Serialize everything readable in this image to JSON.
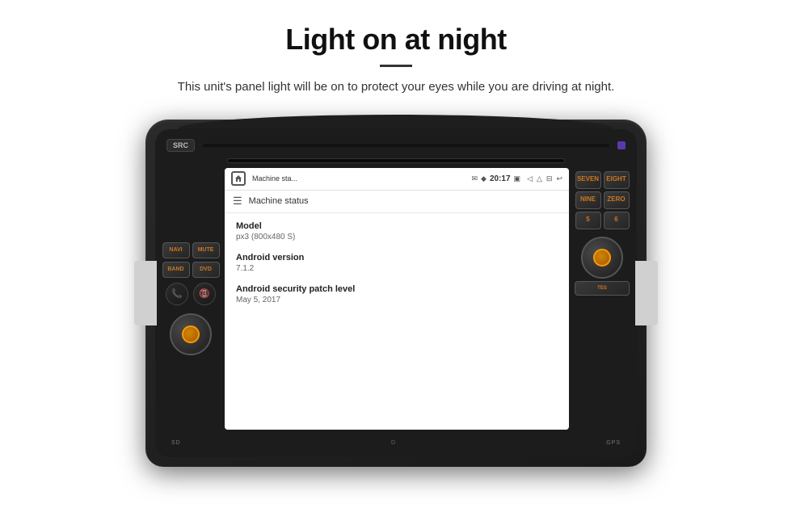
{
  "header": {
    "title": "Light on at night",
    "subtitle": "This unit's panel light will be on to protect your eyes while you are driving at night."
  },
  "device": {
    "src_label": "SRC",
    "navi_label": "NAVI",
    "mute_label": "MUTE",
    "band_label": "BAND",
    "dvd_label": "DVD",
    "seven_label": "SEVEN",
    "eight_label": "EIGHT",
    "nine_label": "NINE",
    "zero_label": "ZERO",
    "sd_label": "SD",
    "gps_label": "GPS",
    "phone_accept": "📞",
    "phone_reject": "📵"
  },
  "screen": {
    "status_bar": {
      "title": "Machine sta...",
      "time": "20:17",
      "message_icon": "✉",
      "location_icon": "♦",
      "photo_icon": "⊞",
      "volume_icon": "◁",
      "media_icon": "△",
      "screen_icon": "⊟",
      "back_icon": "↩"
    },
    "app_header": {
      "title": "Machine status"
    },
    "items": [
      {
        "label": "Model",
        "value": "px3 (800x480 S)"
      },
      {
        "label": "Android version",
        "value": "7.1.2"
      },
      {
        "label": "Android security patch level",
        "value": "May 5, 2017"
      }
    ]
  }
}
